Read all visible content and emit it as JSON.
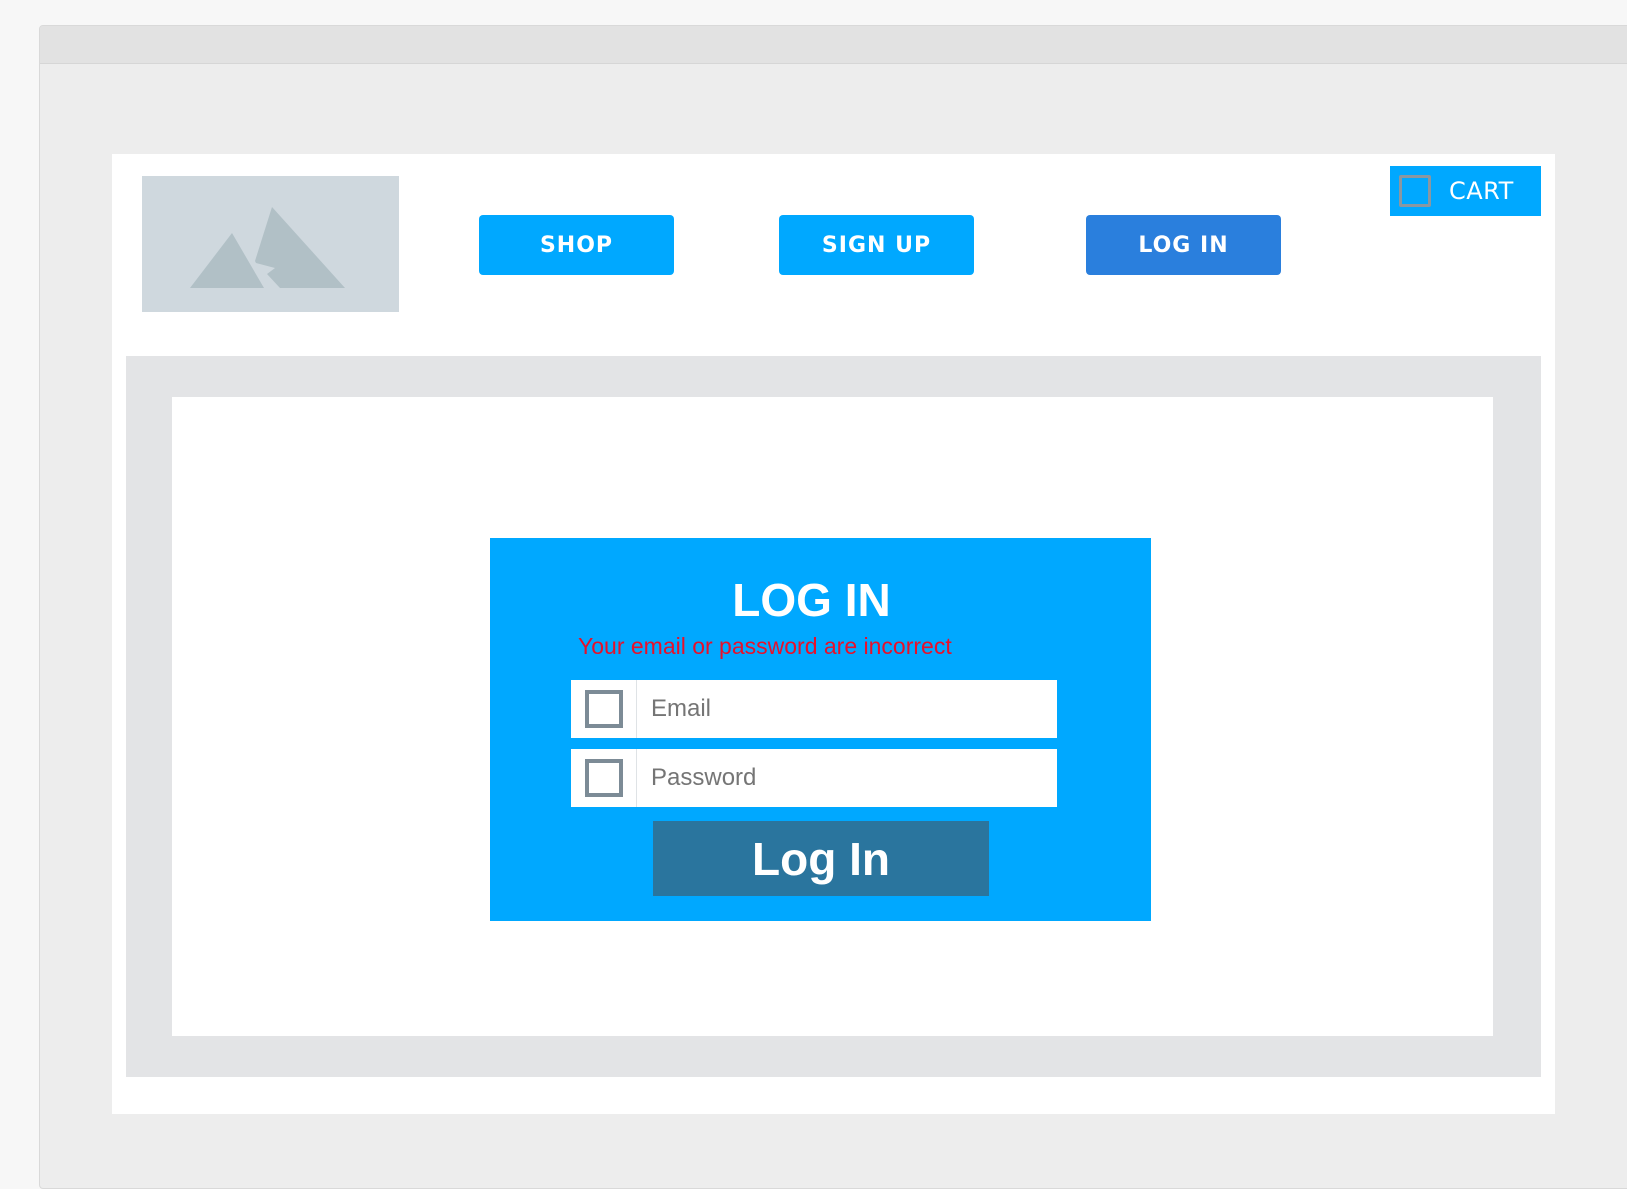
{
  "header": {
    "logo_icon": "image-placeholder-icon",
    "nav": [
      {
        "label": "SHOP",
        "active": false
      },
      {
        "label": "SIGN UP",
        "active": false
      },
      {
        "label": "LOG IN",
        "active": true
      }
    ],
    "cart": {
      "label": "CART",
      "icon": "cart-icon"
    }
  },
  "login": {
    "title": "LOG IN",
    "error": "Your email or password are incorrect",
    "email": {
      "placeholder": "Email",
      "value": "",
      "icon": "email-icon"
    },
    "password": {
      "placeholder": "Password",
      "value": "",
      "icon": "lock-icon"
    },
    "submit_label": "Log In"
  },
  "colors": {
    "accent": "#00a8ff",
    "active_nav": "#2a7fdd",
    "submit": "#2a759e",
    "error": "#e8102a"
  }
}
